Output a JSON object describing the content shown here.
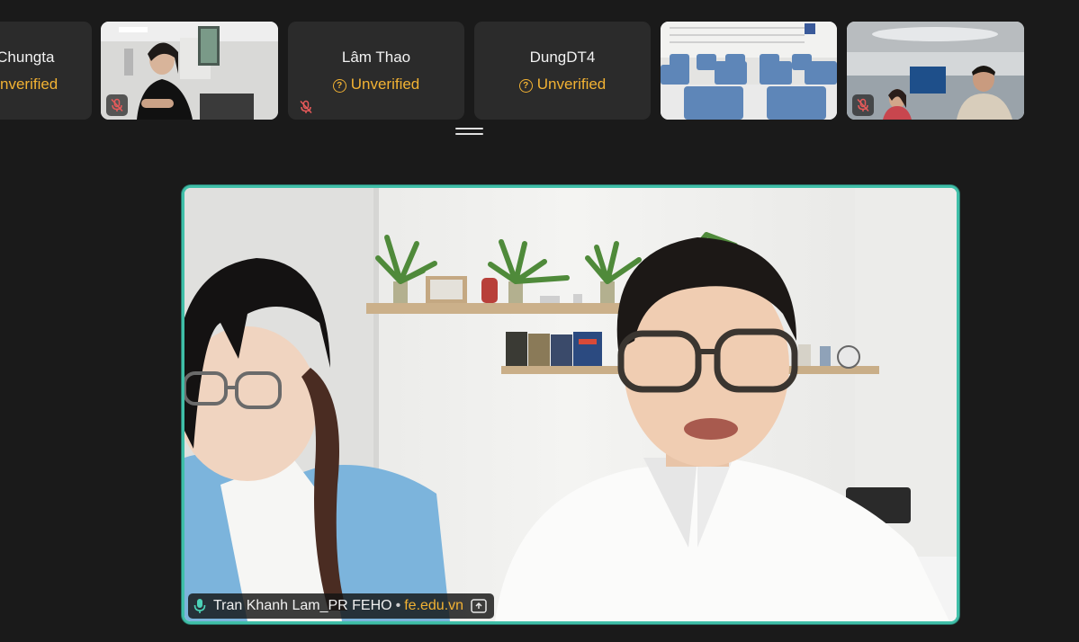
{
  "participants": [
    {
      "name": "g - Chungta",
      "status": "Unverified"
    },
    {
      "video": true,
      "muted": true
    },
    {
      "name": "Lâm Thao",
      "status": "Unverified",
      "muted": true
    },
    {
      "name": "DungDT4",
      "status": "Unverified"
    },
    {
      "video": true,
      "muted": false
    },
    {
      "video": true,
      "muted": true
    }
  ],
  "main_speaker": {
    "name": "Tran Khanh Lam_PR FEHO",
    "separator": "•",
    "domain": "fe.edu.vn"
  },
  "colors": {
    "accent": "#3fbfa8",
    "unverified": "#f2b233",
    "mute": "#e85a5a"
  }
}
